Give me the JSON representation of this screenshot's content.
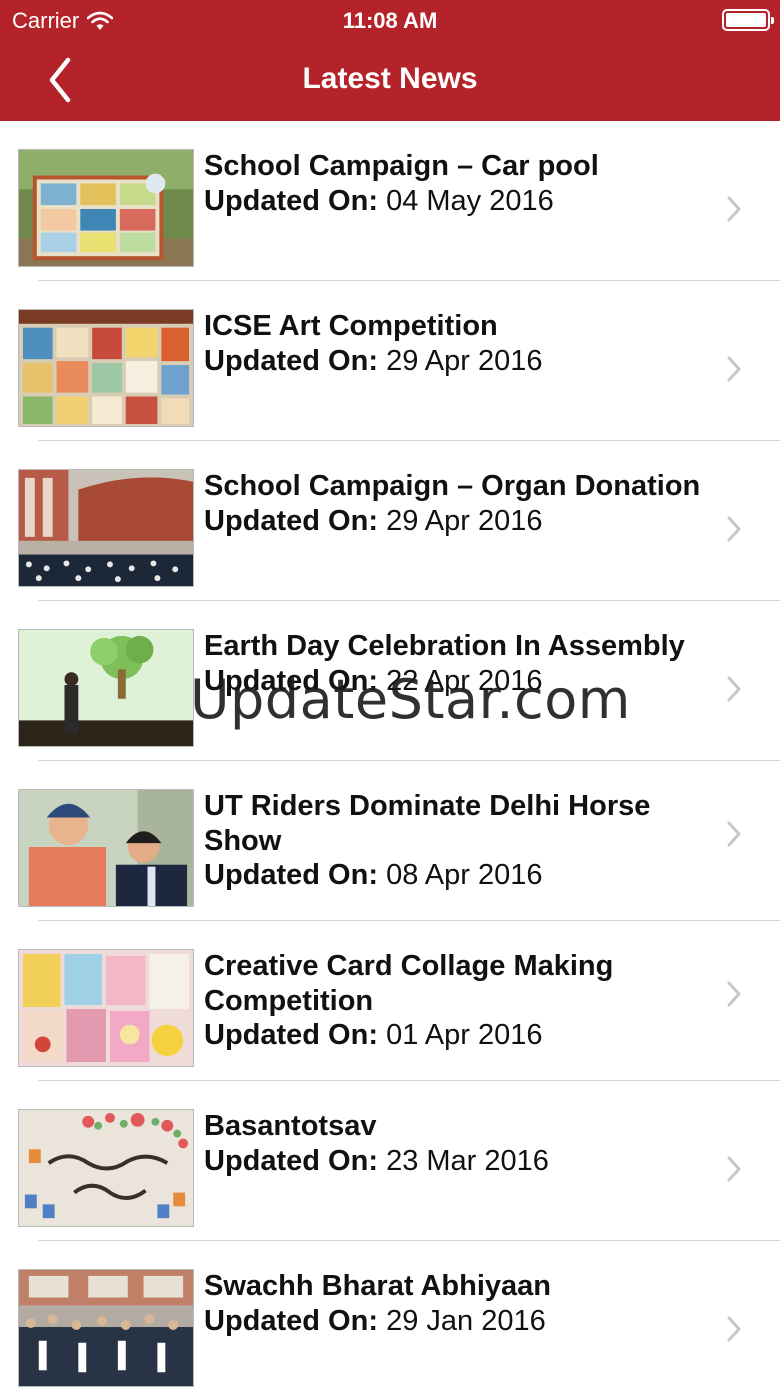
{
  "status_bar": {
    "carrier": "Carrier",
    "time": "11:08 AM"
  },
  "nav": {
    "title": "Latest News",
    "back_icon": "chevron-left-icon"
  },
  "news": [
    {
      "title": "School Campaign – Car pool",
      "date_label": "Updated On:",
      "date": "04 May 2016",
      "thumbnail": "campaign-board-photo"
    },
    {
      "title": "ICSE Art Competition",
      "date_label": "Updated On:",
      "date": "29 Apr 2016",
      "thumbnail": "art-display-photo"
    },
    {
      "title": "School Campaign – Organ Donation",
      "date_label": "Updated On:",
      "date": "29 Apr 2016",
      "thumbnail": "courtyard-assembly-photo"
    },
    {
      "title": "Earth Day Celebration In Assembly",
      "date_label": "Updated On:",
      "date": "22 Apr 2016",
      "thumbnail": "earth-day-stage-photo"
    },
    {
      "title": "UT Riders Dominate Delhi Horse Show",
      "date_label": "Updated On:",
      "date": "08 Apr 2016",
      "thumbnail": "riders-helmets-photo"
    },
    {
      "title": "Creative Card Collage Making Competition",
      "date_label": "Updated On:",
      "date": "01 Apr 2016",
      "thumbnail": "card-collage-photo"
    },
    {
      "title": "Basantotsav",
      "date_label": "Updated On:",
      "date": "23 Mar 2016",
      "thumbnail": "basant-utsav-art-photo"
    },
    {
      "title": "Swachh Bharat Abhiyaan",
      "date_label": "Updated On:",
      "date": "29 Jan 2016",
      "thumbnail": "students-rally-photo"
    }
  ],
  "watermark": "UpdateStar.com",
  "colors": {
    "header_bg": "#b5232a",
    "header_text": "#ffffff",
    "separator": "#d6d6d6",
    "chevron": "#c7c7cc"
  }
}
